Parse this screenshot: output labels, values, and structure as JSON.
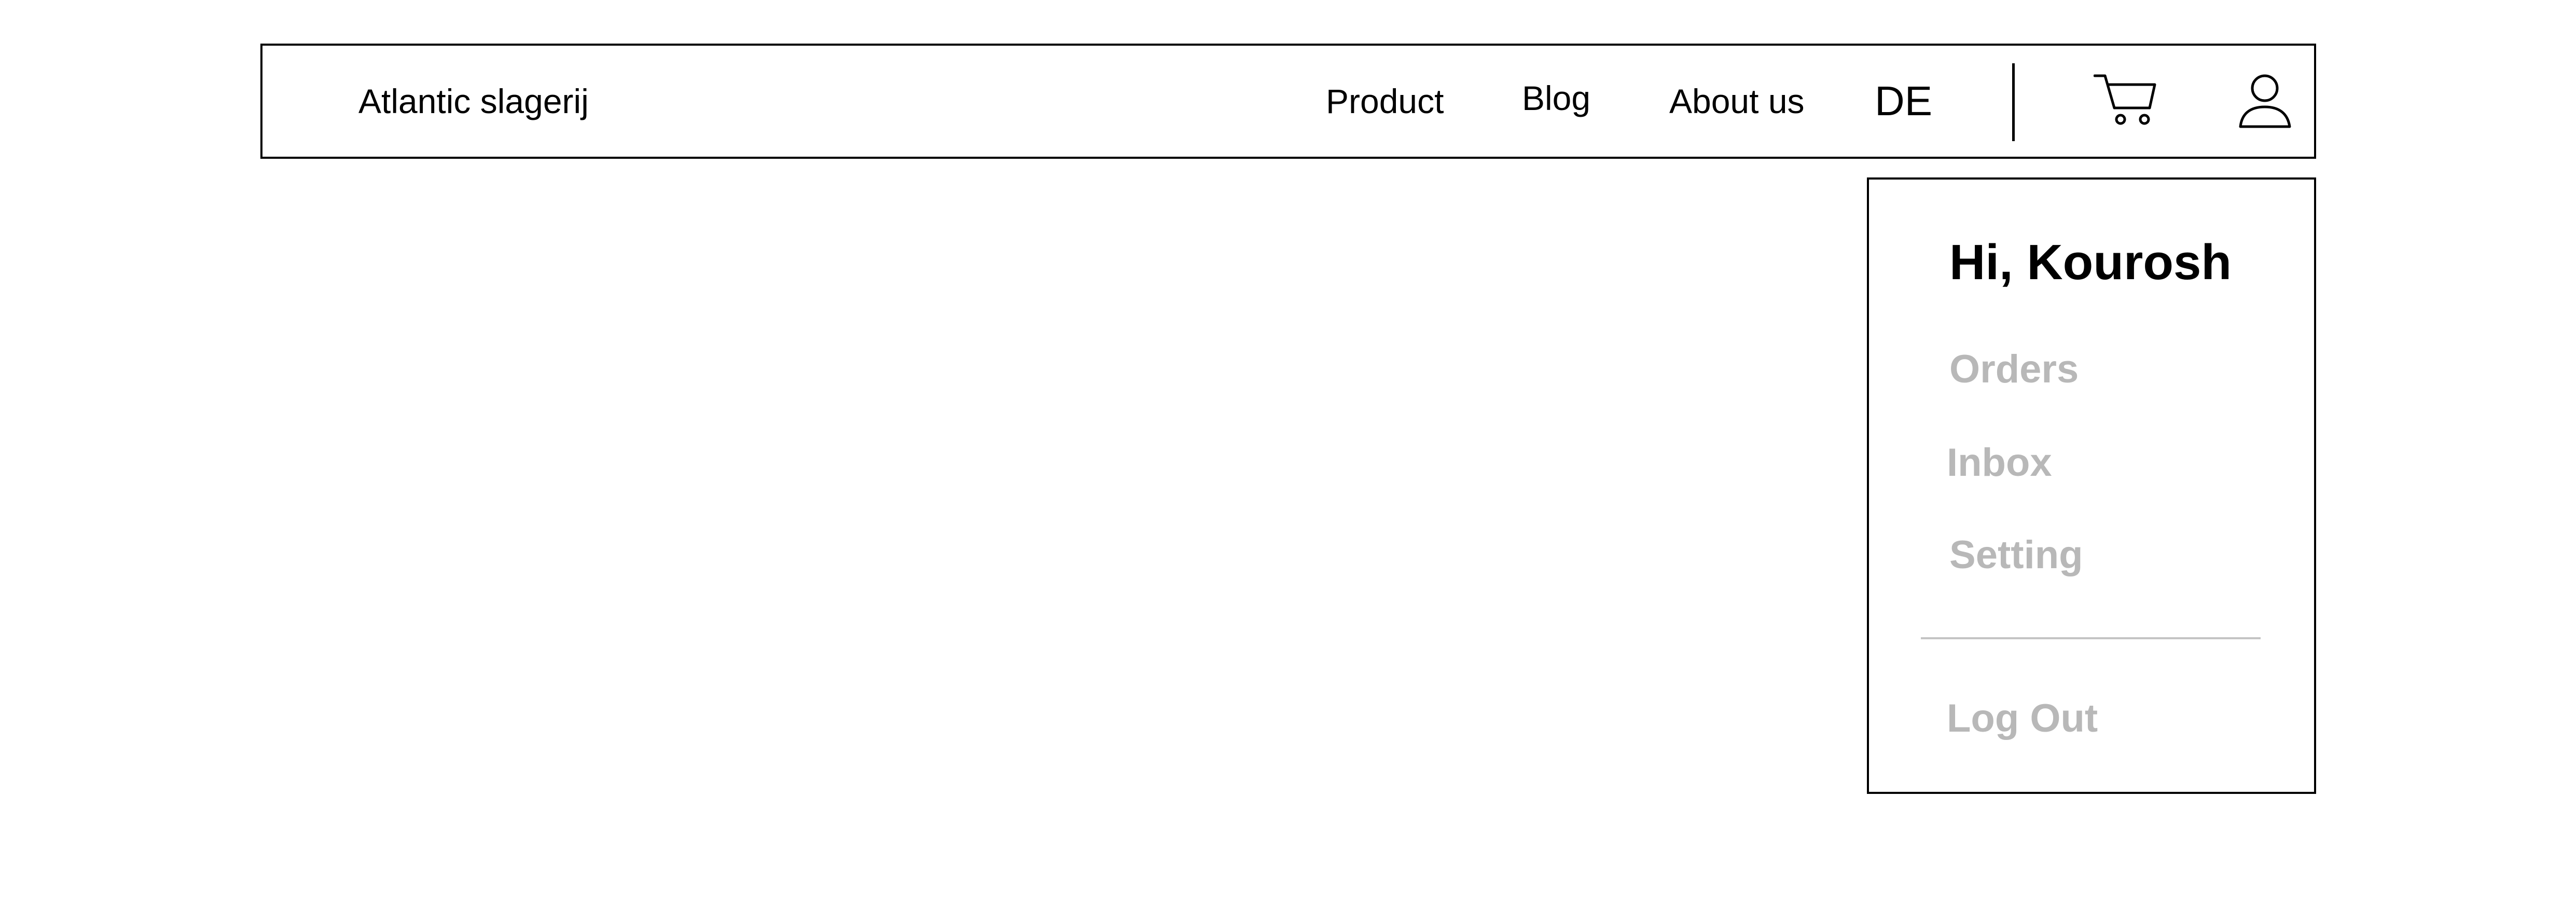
{
  "header": {
    "brand": "Atlantic slagerij",
    "nav_links": [
      "Product",
      "Blog",
      "About us"
    ],
    "language": "DE",
    "cart_icon": "shopping-cart-icon",
    "user_icon": "user-icon"
  },
  "user_menu": {
    "greeting": "Hi, Kourosh",
    "items": [
      "Orders",
      "Inbox",
      "Setting"
    ],
    "logout": "Log Out",
    "item_color": "#b8b8b8",
    "divider_color": "#c4c4c4"
  }
}
